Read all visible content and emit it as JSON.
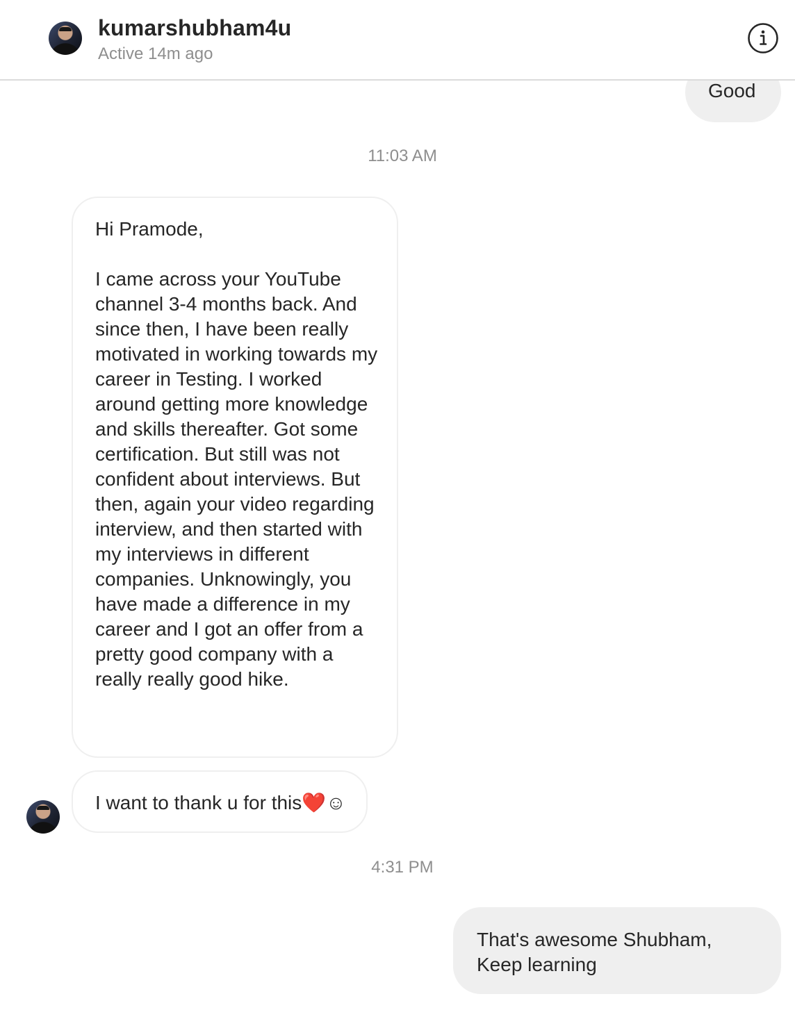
{
  "header": {
    "username": "kumarshubham4u",
    "status": "Active 14m ago",
    "avatar_icon": "profile-photo",
    "info_icon": "info-icon"
  },
  "messages": [
    {
      "direction": "outgoing",
      "text": "Good"
    },
    {
      "type": "timestamp",
      "text": "11:03 AM"
    },
    {
      "direction": "incoming",
      "text": "Hi Pramode,\n\nI came across your YouTube channel 3-4 months back. And since then, I have been really motivated in working towards my career in Testing. I worked around getting more knowledge and skills thereafter. Got some certification. But still was not confident about interviews. But then, again your video regarding interview, and then started with my interviews in different companies. Unknowingly, you have made a difference in my career and I got an offer from a pretty good company with a really really good hike."
    },
    {
      "direction": "incoming",
      "text": "I want to thank u for this❤️☺"
    },
    {
      "type": "timestamp",
      "text": "4:31 PM"
    },
    {
      "direction": "outgoing",
      "text": "That's awesome Shubham,\nKeep learning"
    }
  ],
  "colors": {
    "outgoing_bubble": "#efefef",
    "incoming_border": "#efefef",
    "muted_text": "#8e8e8e",
    "primary_text": "#262626",
    "heart": "#e0245e"
  }
}
